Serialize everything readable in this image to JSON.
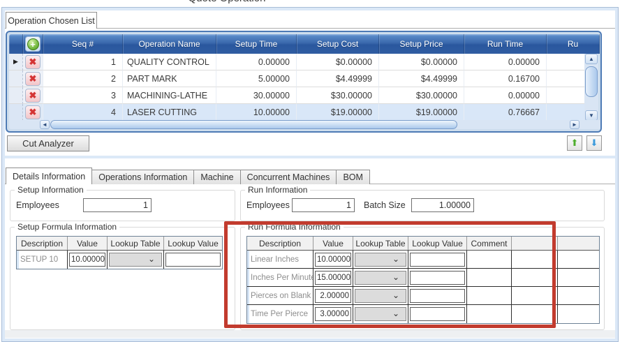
{
  "window": {
    "title": "Quote Operation"
  },
  "top_tab": {
    "label": "Operation Chosen List"
  },
  "grid": {
    "columns": [
      "Seq #",
      "Operation Name",
      "Setup Time",
      "Setup Cost",
      "Setup Price",
      "Run Time",
      "Ru"
    ],
    "rows": [
      {
        "seq": "1",
        "name": "QUALITY CONTROL",
        "setup_time": "0.00000",
        "setup_cost": "$0.00000",
        "setup_price": "$0.00000",
        "run_time": "0.00000",
        "current": true,
        "selected": false
      },
      {
        "seq": "2",
        "name": "PART MARK",
        "setup_time": "5.00000",
        "setup_cost": "$4.49999",
        "setup_price": "$4.49999",
        "run_time": "0.16700",
        "current": false,
        "selected": false
      },
      {
        "seq": "3",
        "name": "MACHINING-LATHE",
        "setup_time": "30.00000",
        "setup_cost": "$30.00000",
        "setup_price": "$30.00000",
        "run_time": "0.00000",
        "current": false,
        "selected": false
      },
      {
        "seq": "4",
        "name": "LASER CUTTING",
        "setup_time": "10.00000",
        "setup_cost": "$19.00000",
        "setup_price": "$19.00000",
        "run_time": "0.76667",
        "current": false,
        "selected": true
      }
    ]
  },
  "buttons": {
    "cut_analyzer": "Cut Analyzer"
  },
  "tabs": [
    "Details Information",
    "Operations Information",
    "Machine",
    "Concurrent Machines",
    "BOM"
  ],
  "setup_information": {
    "title": "Setup Information",
    "employees_label": "Employees",
    "employees_value": "1"
  },
  "run_information": {
    "title": "Run Information",
    "employees_label": "Employees",
    "employees_value": "1",
    "batch_size_label": "Batch Size",
    "batch_size_value": "1.00000"
  },
  "setup_formula": {
    "title": "Setup Formula Information",
    "headers": [
      "Description",
      "Value",
      "Lookup Table",
      "Lookup Value"
    ],
    "rows": [
      {
        "description": "SETUP 10",
        "value": "10.00000",
        "lookup_table": "",
        "lookup_value": ""
      }
    ]
  },
  "run_formula": {
    "title": "Run Formula Information",
    "headers": [
      "Description",
      "Value",
      "Lookup Table",
      "Lookup Value",
      "Comment"
    ],
    "rows": [
      {
        "description": "Linear Inches",
        "value": "10.00000",
        "lookup_table": "",
        "lookup_value": "",
        "comment": ""
      },
      {
        "description": "Inches Per Minute",
        "value": "15.00000",
        "lookup_table": "",
        "lookup_value": "",
        "comment": ""
      },
      {
        "description": "Pierces on Blank",
        "value": "2.00000",
        "lookup_table": "",
        "lookup_value": "",
        "comment": ""
      },
      {
        "description": "Time Per Pierce",
        "value": "3.00000",
        "lookup_table": "",
        "lookup_value": "",
        "comment": ""
      }
    ]
  },
  "icons": {
    "add": "+",
    "delete": "✖",
    "row_current": "▶",
    "up": "▲",
    "down": "▼",
    "left": "◄",
    "right": "►",
    "move_up": "⬆",
    "move_down": "⬇",
    "chevron": "⌄"
  },
  "colors": {
    "grid_header_blue": "#3a68ac",
    "grid_border_blue": "#4d7ab5",
    "selection_blue": "#d9e7f8",
    "annotation_red": "#c23b2e"
  }
}
